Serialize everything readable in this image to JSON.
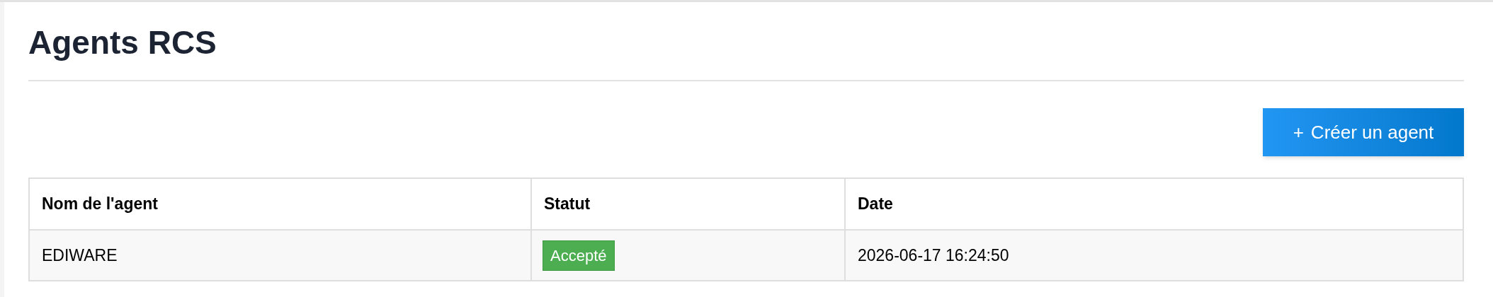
{
  "page": {
    "title": "Agents RCS"
  },
  "create_button": {
    "icon": "+",
    "label": "Créer un agent"
  },
  "table": {
    "columns": [
      "Nom de l'agent",
      "Statut",
      "Date"
    ],
    "rows": [
      {
        "name": "EDIWARE",
        "status": "Accepté",
        "date": "2026-06-17 16:24:50"
      }
    ]
  }
}
